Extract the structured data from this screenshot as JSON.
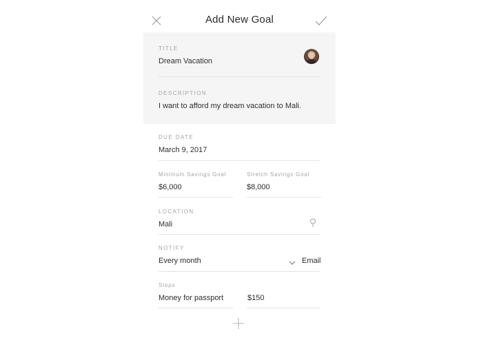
{
  "header": {
    "title": "Add New Goal",
    "close_icon": "close-icon",
    "confirm_icon": "checkmark-icon"
  },
  "form": {
    "title": {
      "label": "TITLE",
      "value": "Dream Vacation"
    },
    "description": {
      "label": "DESCRIPTION",
      "value": "I want to afford my dream vacation to Mali."
    },
    "due_date": {
      "label": "DUE DATE",
      "value": "March 9, 2017"
    },
    "minimum_savings": {
      "label": "Minimum Savings Goal",
      "value": "$6,000"
    },
    "stretch_savings": {
      "label": "Stretch Savings Goal",
      "value": "$8,000"
    },
    "location": {
      "label": "LOCATION",
      "value": "Mali",
      "icon": "location-pin-icon"
    },
    "notify": {
      "label": "NOTIFY",
      "frequency": "Every month",
      "method": "Email",
      "icon": "chevron-down-icon"
    },
    "steps": {
      "label": "Steps",
      "items": [
        {
          "name": "Money for passport",
          "amount": "$150"
        }
      ]
    },
    "add_icon": "plus-icon"
  },
  "colors": {
    "panel_background": "#f5f5f5",
    "divider": "#e3e3e3",
    "label": "#a5a5a5",
    "text": "#2e2e2e"
  }
}
